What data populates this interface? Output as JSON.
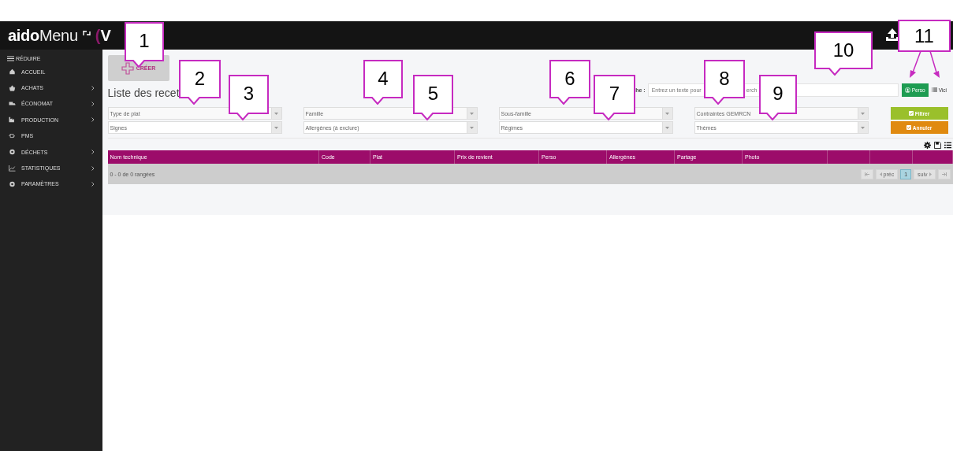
{
  "header": {
    "logo_bold": "aido",
    "logo_light": "Menu",
    "version_paren": "(",
    "version_letter": "V"
  },
  "sidebar": {
    "collapse": "RÉDUIRE",
    "items": [
      {
        "label": "ACCUEIL",
        "has_submenu": false
      },
      {
        "label": "ACHATS",
        "has_submenu": true
      },
      {
        "label": "ÉCONOMAT",
        "has_submenu": true
      },
      {
        "label": "PRODUCTION",
        "has_submenu": true
      },
      {
        "label": "PMS",
        "has_submenu": false
      },
      {
        "label": "DÉCHETS",
        "has_submenu": true
      },
      {
        "label": "STATISTIQUES",
        "has_submenu": true
      },
      {
        "label": "PARAMÈTRES",
        "has_submenu": true
      }
    ]
  },
  "toolbar": {
    "create": "CRÉER",
    "title": "Liste des recet",
    "search_label": "he :",
    "search_placeholder": "Entrez un texte pour",
    "search_fragment": "erch",
    "views": [
      {
        "label": "Perso",
        "selected": true
      },
      {
        "label": "Vici",
        "selected": false
      }
    ]
  },
  "filters": [
    [
      "Type de plat",
      "Signes"
    ],
    [
      "Famille",
      "Allergènes (à exclure)"
    ],
    [
      "Sous-famille",
      "Régimes"
    ],
    [
      "Contraintes GEMRCN",
      "Thèmes"
    ]
  ],
  "actions": [
    {
      "label": "Filtrer",
      "kind": "filter"
    },
    {
      "label": "Annuler",
      "kind": "cancel"
    }
  ],
  "table": {
    "columns": [
      "Nom technique",
      "Code",
      "Plat",
      "Prix de revient",
      "Perso",
      "Allergènes",
      "Partage",
      "Photo"
    ],
    "summary": "0 - 0 de 0 rangées",
    "prev": "préc",
    "next": "suiv",
    "pages": [
      {
        "label": "1",
        "selected": true
      }
    ]
  },
  "callouts": [
    {
      "number": "1"
    },
    {
      "number": "2"
    },
    {
      "number": "3"
    },
    {
      "number": "4"
    },
    {
      "number": "5"
    },
    {
      "number": "6"
    },
    {
      "number": "7"
    },
    {
      "number": "8"
    },
    {
      "number": "9"
    },
    {
      "number": "10"
    },
    {
      "number": "11"
    }
  ]
}
